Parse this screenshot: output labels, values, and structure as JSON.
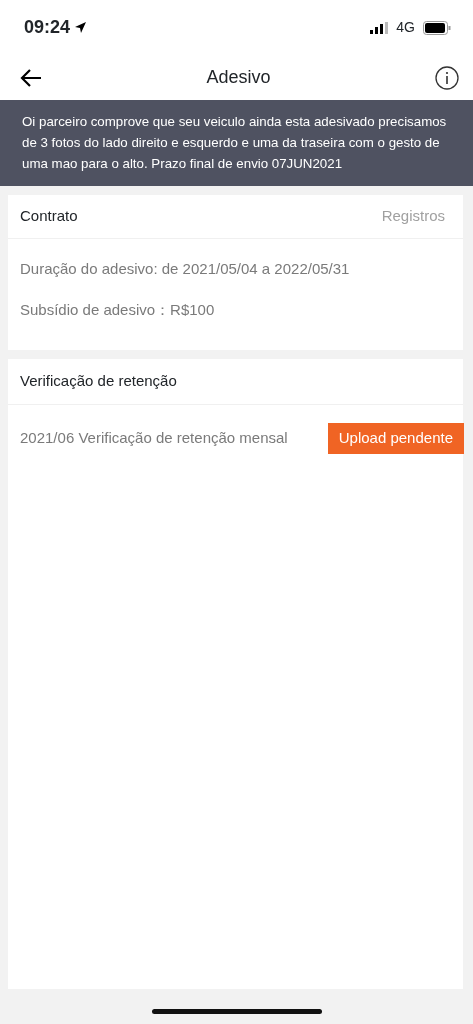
{
  "status_bar": {
    "time": "09:24",
    "network": "4G"
  },
  "header": {
    "title": "Adesivo"
  },
  "notice": "Oi parceiro comprove que seu veiculo ainda esta adesivado precisamos de 3 fotos do lado direito e esquerdo e uma da traseira com o gesto de uma mao para o alto. Prazo final de envio 07JUN2021",
  "contract": {
    "title": "Contrato",
    "link": "Registros",
    "lines": [
      "Duração do adesivo: de 2021/05/04 a 2022/05/31",
      "Subsídio de adesivo：R$100"
    ]
  },
  "retention": {
    "title": "Verificação de retenção",
    "items": [
      {
        "label": "2021/06 Verificação de retenção mensal",
        "action": "Upload pendente"
      }
    ]
  }
}
